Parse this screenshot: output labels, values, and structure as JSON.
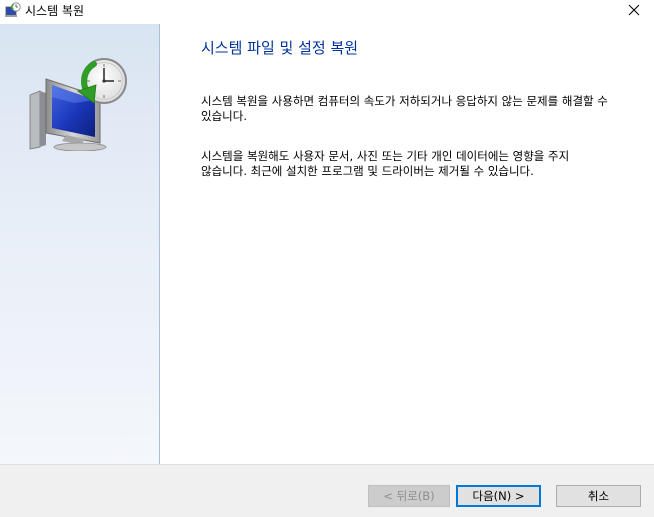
{
  "window": {
    "title": "시스템 복원",
    "icon": "system-restore-icon"
  },
  "content": {
    "heading": "시스템 파일 및 설정 복원",
    "paragraph1": "시스템 복원을 사용하면 컴퓨터의 속도가 저하되거나 응답하지 않는 문제를 해결할 수 있습니다.",
    "paragraph2": "시스템을 복원해도 사용자 문서, 사진 또는 기타 개인 데이터에는 영향을 주지 않습니다. 최근에 설치한 프로그램 및 드라이버는 제거될 수 있습니다."
  },
  "buttons": {
    "back": "< 뒤로(B)",
    "next": "다음(N) >",
    "cancel": "취소"
  },
  "colors": {
    "heading": "#003399",
    "focus_border": "#0078d7",
    "sidepanel_top": "#d9e4f2"
  }
}
